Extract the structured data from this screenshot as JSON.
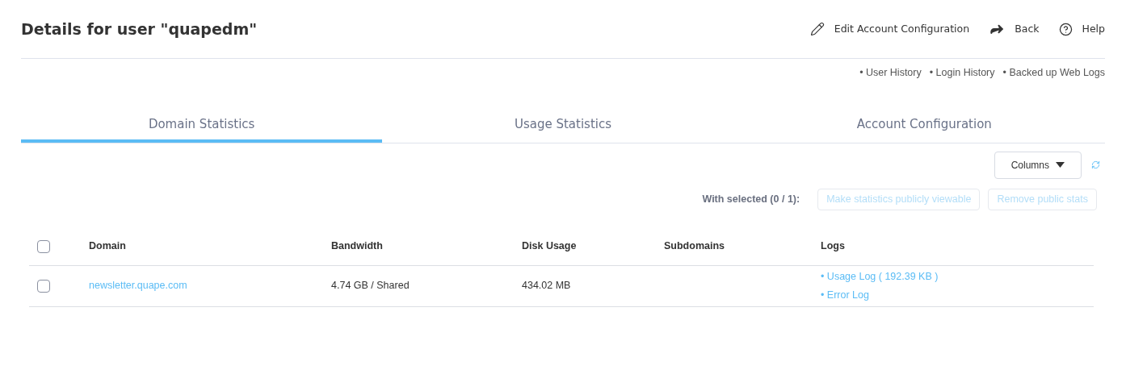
{
  "title": "Details for user \"quapedm\"",
  "actions": [
    {
      "kind": "edit",
      "label": "Edit Account Configuration"
    },
    {
      "kind": "back",
      "label": "Back"
    },
    {
      "kind": "help",
      "label": "Help"
    }
  ],
  "history_links": [
    "• User History",
    "• Login History",
    "• Backed up Web Logs"
  ],
  "tabs": [
    {
      "label": "Domain Statistics",
      "selected": true
    },
    {
      "label": "Usage Statistics",
      "selected": false
    },
    {
      "label": "Account Configuration",
      "selected": false
    }
  ],
  "columns_button": "Columns",
  "with_selected": "With selected (0 / 1):",
  "bulk_buttons": [
    {
      "label": "Make statistics publicly viewable",
      "disabled": true
    },
    {
      "label": "Remove public stats",
      "disabled": true
    }
  ],
  "table": {
    "select_all_checked": false,
    "columns": [
      "Domain",
      "Bandwidth",
      "Disk Usage",
      "Subdomains",
      "Logs"
    ],
    "rows": [
      {
        "checked": false,
        "domain": "newsletter.quape.com",
        "bandwidth": "4.74 GB / Shared",
        "disk_usage": "434.02 MB",
        "logs": [
          "• Usage Log ( 192.39 KB )",
          "• Error Log"
        ]
      }
    ]
  }
}
